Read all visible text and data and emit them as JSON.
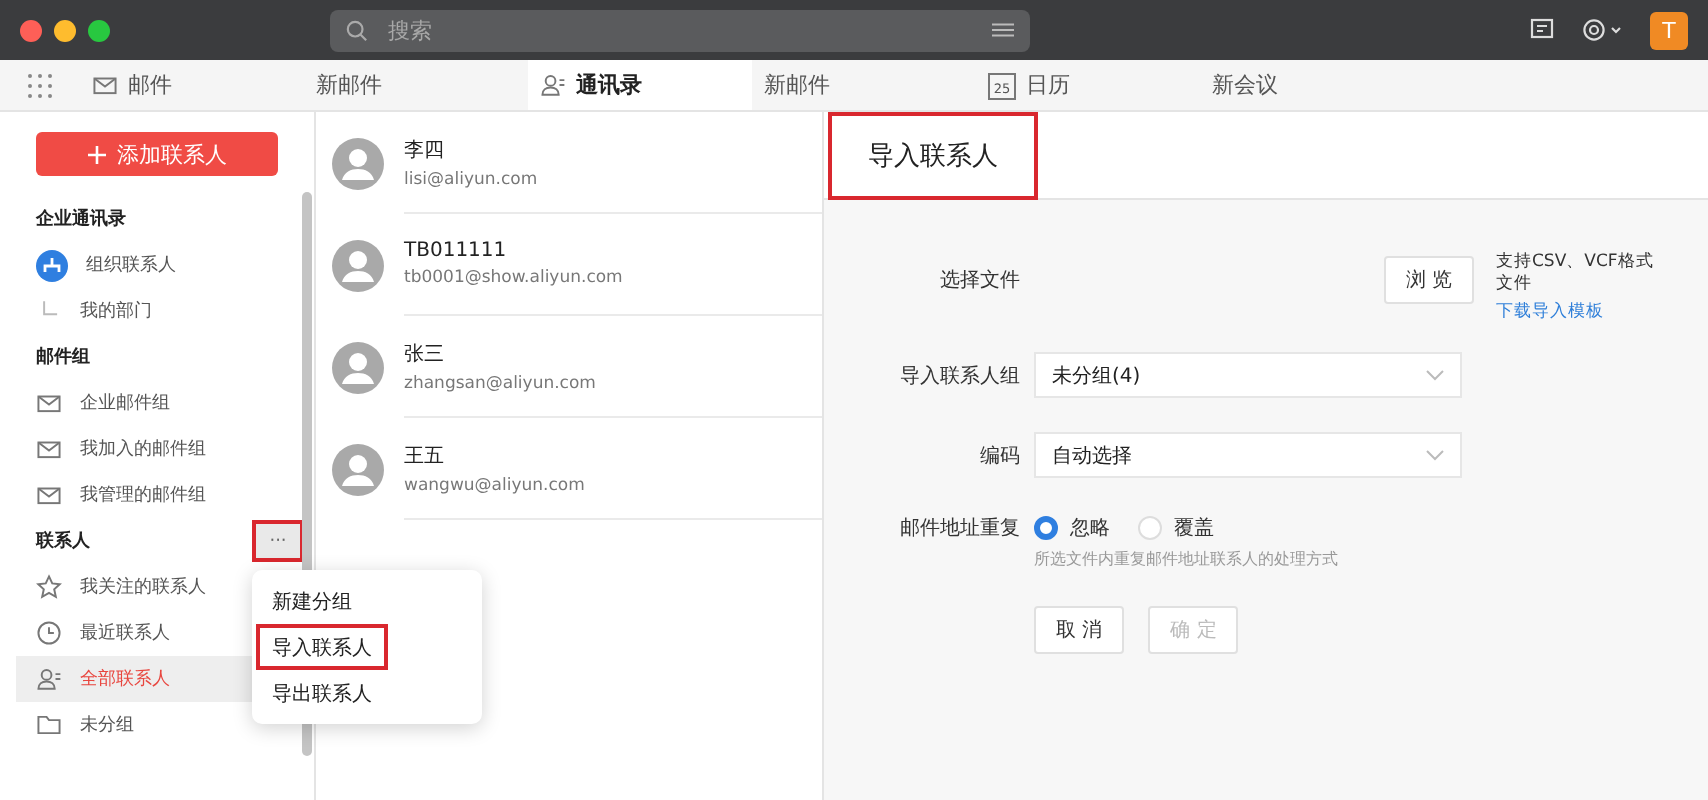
{
  "window": {
    "search_placeholder": "搜索",
    "avatar_letter": "T"
  },
  "tabs": [
    {
      "label": "邮件",
      "kind": "mail",
      "selected": false
    },
    {
      "label": "新邮件",
      "selected": false
    },
    {
      "label": "通讯录",
      "kind": "contacts",
      "selected": true
    },
    {
      "label": "新邮件",
      "selected": false
    },
    {
      "label": "日历",
      "kind": "calendar",
      "calendar_day": "25",
      "selected": false
    },
    {
      "label": "新会议",
      "selected": false
    }
  ],
  "sidebar": {
    "add_button": "添加联系人",
    "sections": [
      {
        "title": "企业通讯录",
        "items": [
          {
            "label": "组织联系人",
            "kind": "org",
            "selected": false
          },
          {
            "label": "我的部门",
            "kind": "branch",
            "selected": false
          }
        ]
      },
      {
        "title": "邮件组",
        "items": [
          {
            "label": "企业邮件组",
            "kind": "mail",
            "selected": false
          },
          {
            "label": "我加入的邮件组",
            "kind": "mail",
            "selected": false
          },
          {
            "label": "我管理的邮件组",
            "kind": "mail",
            "selected": false
          }
        ]
      },
      {
        "title": "联系人",
        "more_button": {
          "label": "···",
          "highlighted": true
        },
        "items": [
          {
            "label": "我关注的联系人",
            "kind": "star",
            "selected": false
          },
          {
            "label": "最近联系人",
            "kind": "clock",
            "selected": false
          },
          {
            "label": "全部联系人",
            "kind": "contacts",
            "selected": true
          },
          {
            "label": "未分组",
            "kind": "folder",
            "selected": false
          }
        ]
      }
    ]
  },
  "menu": {
    "items": [
      {
        "label": "新建分组",
        "highlighted": false
      },
      {
        "label": "导入联系人",
        "highlighted": true
      },
      {
        "label": "导出联系人",
        "highlighted": false
      }
    ]
  },
  "contacts": [
    {
      "name": "李四",
      "email": "lisi@aliyun.com"
    },
    {
      "name": "TB011111",
      "email": "tb0001@show.aliyun.com"
    },
    {
      "name": "张三",
      "email": "zhangsan@aliyun.com"
    },
    {
      "name": "王五",
      "email": "wangwu@aliyun.com"
    }
  ],
  "panel": {
    "title": "导入联系人",
    "title_highlighted": true,
    "file_label": "选择文件",
    "browse_button": "浏 览",
    "file_note": "支持CSV、VCF格式文件",
    "template_link": "下载导入模板",
    "group_label": "导入联系人组",
    "group_value": "未分组(4)",
    "encoding_label": "编码",
    "encoding_value": "自动选择",
    "duplicate_label": "邮件地址重复",
    "duplicate_options": [
      {
        "label": "忽略",
        "selected": true
      },
      {
        "label": "覆盖",
        "selected": false
      }
    ],
    "duplicate_hint": "所选文件内重复邮件地址联系人的处理方式",
    "cancel_button": "取 消",
    "confirm_button": {
      "label": "确 定",
      "disabled": true
    }
  }
}
